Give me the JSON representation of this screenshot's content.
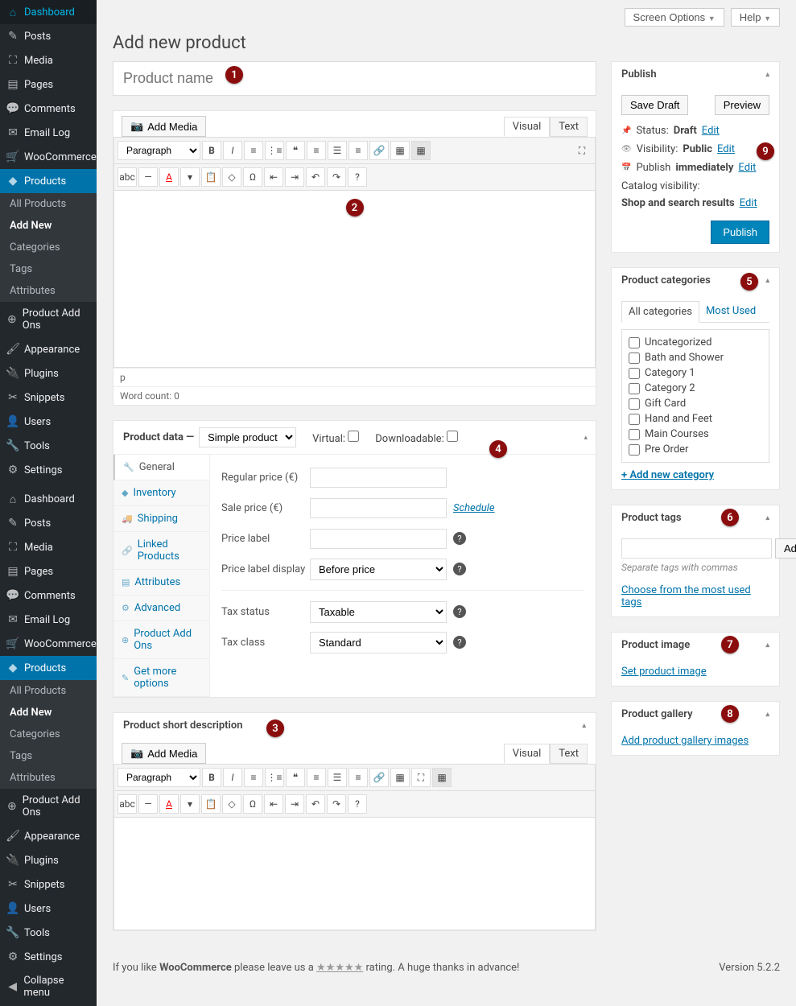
{
  "topbar": {
    "screen_options": "Screen Options",
    "help": "Help"
  },
  "page_title": "Add new product",
  "title_placeholder": "Product name",
  "sidebar": {
    "items": [
      {
        "icon": "⌂",
        "label": "Dashboard"
      },
      {
        "icon": "✎",
        "label": "Posts"
      },
      {
        "icon": "⛶",
        "label": "Media"
      },
      {
        "icon": "▤",
        "label": "Pages"
      },
      {
        "icon": "💬",
        "label": "Comments"
      },
      {
        "icon": "✉",
        "label": "Email Log"
      },
      {
        "icon": "🛒",
        "label": "WooCommerce"
      },
      {
        "icon": "◆",
        "label": "Products",
        "open": true,
        "subs": [
          "All Products",
          "Add New",
          "Categories",
          "Tags",
          "Attributes"
        ]
      },
      {
        "icon": "⊕",
        "label": "Product Add Ons"
      },
      {
        "icon": "🖌",
        "label": "Appearance"
      },
      {
        "icon": "🔌",
        "label": "Plugins"
      },
      {
        "icon": "✂",
        "label": "Snippets"
      },
      {
        "icon": "👤",
        "label": "Users"
      },
      {
        "icon": "🔧",
        "label": "Tools"
      },
      {
        "icon": "⚙",
        "label": "Settings"
      }
    ],
    "repeat_from": 0,
    "collapse": "Collapse menu"
  },
  "editor": {
    "add_media": "Add Media",
    "visual": "Visual",
    "text_tab": "Text",
    "paragraph": "Paragraph",
    "path": "p",
    "wordcount": "Word count: 0"
  },
  "product_data": {
    "title": "Product data —",
    "type": "Simple product",
    "virtual": "Virtual:",
    "downloadable": "Downloadable:",
    "tabs": [
      "General",
      "Inventory",
      "Shipping",
      "Linked Products",
      "Attributes",
      "Advanced",
      "Product Add Ons",
      "Get more options"
    ],
    "fields": {
      "regular_price": "Regular price (€)",
      "sale_price": "Sale price (€)",
      "schedule": "Schedule",
      "price_label": "Price label",
      "price_label_display": "Price label display",
      "before_price": "Before price",
      "tax_status": "Tax status",
      "taxable": "Taxable",
      "tax_class": "Tax class",
      "standard": "Standard"
    }
  },
  "short_desc": {
    "title": "Product short description"
  },
  "publish": {
    "title": "Publish",
    "save_draft": "Save Draft",
    "preview": "Preview",
    "status_label": "Status:",
    "status_value": "Draft",
    "visibility_label": "Visibility:",
    "visibility_value": "Public",
    "publish_label": "Publish",
    "publish_value": "immediately",
    "catalog_label": "Catalog visibility:",
    "catalog_value": "Shop and search results",
    "edit": "Edit",
    "publish_btn": "Publish"
  },
  "categories": {
    "title": "Product categories",
    "tab_all": "All categories",
    "tab_most": "Most Used",
    "items": [
      "Uncategorized",
      "Bath and Shower",
      "Category 1",
      "Category 2",
      "Gift Card",
      "Hand and Feet",
      "Main Courses",
      "Pre Order"
    ],
    "add_new": "+ Add new category"
  },
  "tags": {
    "title": "Product tags",
    "add": "Add",
    "note": "Separate tags with commas",
    "choose": "Choose from the most used tags"
  },
  "image": {
    "title": "Product image",
    "set": "Set product image"
  },
  "gallery": {
    "title": "Product gallery",
    "add": "Add product gallery images"
  },
  "badges": [
    "1",
    "2",
    "3",
    "4",
    "5",
    "6",
    "7",
    "8",
    "9"
  ],
  "footer": {
    "like": "If you like",
    "wc": "WooCommerce",
    "leave": "please leave us a",
    "rating": "rating. A huge thanks in advance!",
    "version": "Version 5.2.2"
  }
}
